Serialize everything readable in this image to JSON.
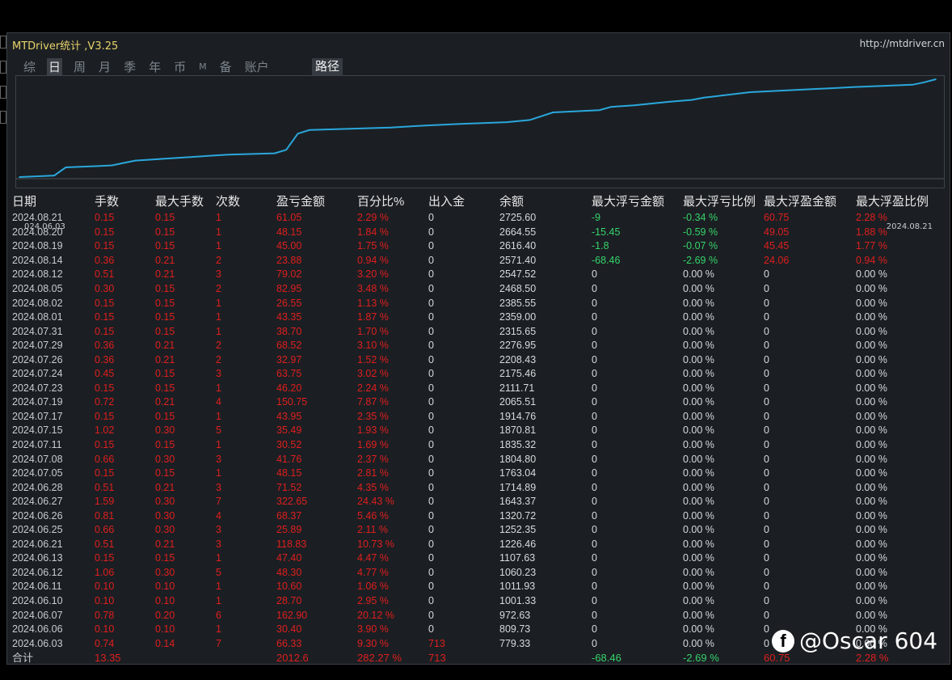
{
  "window": {
    "title": "MTDriver统计 ,V3.25",
    "url": "http://mtdriver.cn"
  },
  "tabs": [
    {
      "label": "综",
      "active": false
    },
    {
      "label": "日",
      "active": true
    },
    {
      "label": "周",
      "active": false
    },
    {
      "label": "月",
      "active": false
    },
    {
      "label": "季",
      "active": false
    },
    {
      "label": "年",
      "active": false
    },
    {
      "label": "币",
      "active": false
    },
    {
      "label": "M",
      "active": false
    },
    {
      "label": "备",
      "active": false
    },
    {
      "label": "账户",
      "active": false
    }
  ],
  "path_button": "路径",
  "chart_data": {
    "type": "line",
    "x_start_label": "024.06.03",
    "x_end_label": "2024.08.21",
    "x": [
      "2024.06.03",
      "2024.06.06",
      "2024.06.07",
      "2024.06.10",
      "2024.06.11",
      "2024.06.12",
      "2024.06.13",
      "2024.06.21",
      "2024.06.25",
      "2024.06.26",
      "2024.06.27",
      "2024.06.28",
      "2024.07.05",
      "2024.07.08",
      "2024.07.11",
      "2024.07.15",
      "2024.07.17",
      "2024.07.19",
      "2024.07.23",
      "2024.07.24",
      "2024.07.26",
      "2024.07.29",
      "2024.07.31",
      "2024.08.01",
      "2024.08.02",
      "2024.08.05",
      "2024.08.12",
      "2024.08.14",
      "2024.08.19",
      "2024.08.20",
      "2024.08.21"
    ],
    "values": [
      779.33,
      809.73,
      972.63,
      1001.33,
      1011.93,
      1060.23,
      1107.63,
      1226.46,
      1252.35,
      1320.72,
      1643.37,
      1714.89,
      1763.04,
      1804.8,
      1835.32,
      1870.81,
      1914.76,
      2065.51,
      2111.71,
      2175.46,
      2208.43,
      2276.95,
      2315.65,
      2359.0,
      2385.55,
      2468.5,
      2547.52,
      2571.4,
      2616.4,
      2664.55,
      2725.6
    ],
    "line_color": "#2aa7dc"
  },
  "table": {
    "headers": [
      "日期",
      "手数",
      "最大手数",
      "次数",
      "盈亏金额",
      "百分比%",
      "出入金",
      "余额",
      "最大浮亏金额",
      "最大浮亏比例",
      "最大浮盈金额",
      "最大浮盈比例"
    ],
    "rows": [
      [
        "2024.08.21",
        "0.15",
        "0.15",
        "1",
        "61.05",
        "2.29 %",
        "0",
        "2725.60",
        "-9",
        "-0.34 %",
        "60.75",
        "2.28 %"
      ],
      [
        "2024.08.20",
        "0.15",
        "0.15",
        "1",
        "48.15",
        "1.84 %",
        "0",
        "2664.55",
        "-15.45",
        "-0.59 %",
        "49.05",
        "1.88 %"
      ],
      [
        "2024.08.19",
        "0.15",
        "0.15",
        "1",
        "45.00",
        "1.75 %",
        "0",
        "2616.40",
        "-1.8",
        "-0.07 %",
        "45.45",
        "1.77 %"
      ],
      [
        "2024.08.14",
        "0.36",
        "0.21",
        "2",
        "23.88",
        "0.94 %",
        "0",
        "2571.40",
        "-68.46",
        "-2.69 %",
        "24.06",
        "0.94 %"
      ],
      [
        "2024.08.12",
        "0.51",
        "0.21",
        "3",
        "79.02",
        "3.20 %",
        "0",
        "2547.52",
        "0",
        "0.00 %",
        "0",
        "0.00 %"
      ],
      [
        "2024.08.05",
        "0.30",
        "0.15",
        "2",
        "82.95",
        "3.48 %",
        "0",
        "2468.50",
        "0",
        "0.00 %",
        "0",
        "0.00 %"
      ],
      [
        "2024.08.02",
        "0.15",
        "0.15",
        "1",
        "26.55",
        "1.13 %",
        "0",
        "2385.55",
        "0",
        "0.00 %",
        "0",
        "0.00 %"
      ],
      [
        "2024.08.01",
        "0.15",
        "0.15",
        "1",
        "43.35",
        "1.87 %",
        "0",
        "2359.00",
        "0",
        "0.00 %",
        "0",
        "0.00 %"
      ],
      [
        "2024.07.31",
        "0.15",
        "0.15",
        "1",
        "38.70",
        "1.70 %",
        "0",
        "2315.65",
        "0",
        "0.00 %",
        "0",
        "0.00 %"
      ],
      [
        "2024.07.29",
        "0.36",
        "0.21",
        "2",
        "68.52",
        "3.10 %",
        "0",
        "2276.95",
        "0",
        "0.00 %",
        "0",
        "0.00 %"
      ],
      [
        "2024.07.26",
        "0.36",
        "0.21",
        "2",
        "32.97",
        "1.52 %",
        "0",
        "2208.43",
        "0",
        "0.00 %",
        "0",
        "0.00 %"
      ],
      [
        "2024.07.24",
        "0.45",
        "0.15",
        "3",
        "63.75",
        "3.02 %",
        "0",
        "2175.46",
        "0",
        "0.00 %",
        "0",
        "0.00 %"
      ],
      [
        "2024.07.23",
        "0.15",
        "0.15",
        "1",
        "46.20",
        "2.24 %",
        "0",
        "2111.71",
        "0",
        "0.00 %",
        "0",
        "0.00 %"
      ],
      [
        "2024.07.19",
        "0.72",
        "0.21",
        "4",
        "150.75",
        "7.87 %",
        "0",
        "2065.51",
        "0",
        "0.00 %",
        "0",
        "0.00 %"
      ],
      [
        "2024.07.17",
        "0.15",
        "0.15",
        "1",
        "43.95",
        "2.35 %",
        "0",
        "1914.76",
        "0",
        "0.00 %",
        "0",
        "0.00 %"
      ],
      [
        "2024.07.15",
        "1.02",
        "0.30",
        "5",
        "35.49",
        "1.93 %",
        "0",
        "1870.81",
        "0",
        "0.00 %",
        "0",
        "0.00 %"
      ],
      [
        "2024.07.11",
        "0.15",
        "0.15",
        "1",
        "30.52",
        "1.69 %",
        "0",
        "1835.32",
        "0",
        "0.00 %",
        "0",
        "0.00 %"
      ],
      [
        "2024.07.08",
        "0.66",
        "0.30",
        "3",
        "41.76",
        "2.37 %",
        "0",
        "1804.80",
        "0",
        "0.00 %",
        "0",
        "0.00 %"
      ],
      [
        "2024.07.05",
        "0.15",
        "0.15",
        "1",
        "48.15",
        "2.81 %",
        "0",
        "1763.04",
        "0",
        "0.00 %",
        "0",
        "0.00 %"
      ],
      [
        "2024.06.28",
        "0.51",
        "0.21",
        "3",
        "71.52",
        "4.35 %",
        "0",
        "1714.89",
        "0",
        "0.00 %",
        "0",
        "0.00 %"
      ],
      [
        "2024.06.27",
        "1.59",
        "0.30",
        "7",
        "322.65",
        "24.43 %",
        "0",
        "1643.37",
        "0",
        "0.00 %",
        "0",
        "0.00 %"
      ],
      [
        "2024.06.26",
        "0.81",
        "0.30",
        "4",
        "68.37",
        "5.46 %",
        "0",
        "1320.72",
        "0",
        "0.00 %",
        "0",
        "0.00 %"
      ],
      [
        "2024.06.25",
        "0.66",
        "0.30",
        "3",
        "25.89",
        "2.11 %",
        "0",
        "1252.35",
        "0",
        "0.00 %",
        "0",
        "0.00 %"
      ],
      [
        "2024.06.21",
        "0.51",
        "0.21",
        "3",
        "118.83",
        "10.73 %",
        "0",
        "1226.46",
        "0",
        "0.00 %",
        "0",
        "0.00 %"
      ],
      [
        "2024.06.13",
        "0.15",
        "0.15",
        "1",
        "47.40",
        "4.47 %",
        "0",
        "1107.63",
        "0",
        "0.00 %",
        "0",
        "0.00 %"
      ],
      [
        "2024.06.12",
        "1.06",
        "0.30",
        "5",
        "48.30",
        "4.77 %",
        "0",
        "1060.23",
        "0",
        "0.00 %",
        "0",
        "0.00 %"
      ],
      [
        "2024.06.11",
        "0.10",
        "0.10",
        "1",
        "10.60",
        "1.06 %",
        "0",
        "1011.93",
        "0",
        "0.00 %",
        "0",
        "0.00 %"
      ],
      [
        "2024.06.10",
        "0.10",
        "0.10",
        "1",
        "28.70",
        "2.95 %",
        "0",
        "1001.33",
        "0",
        "0.00 %",
        "0",
        "0.00 %"
      ],
      [
        "2024.06.07",
        "0.78",
        "0.20",
        "6",
        "162.90",
        "20.12 %",
        "0",
        "972.63",
        "0",
        "0.00 %",
        "0",
        "0.00 %"
      ],
      [
        "2024.06.06",
        "0.10",
        "0.10",
        "1",
        "30.40",
        "3.90 %",
        "0",
        "809.73",
        "0",
        "0.00 %",
        "0",
        "0.00 %"
      ],
      [
        "2024.06.03",
        "0.74",
        "0.14",
        "7",
        "66.33",
        "9.30 %",
        "713",
        "779.33",
        "0",
        "0.00 %",
        "0",
        "0.00 %"
      ]
    ],
    "total": [
      "合计",
      "13.35",
      "",
      "",
      "2012.6",
      "282.27 %",
      "713",
      "",
      "-68.46",
      "-2.69 %",
      "60.75",
      "2.28 %"
    ]
  },
  "watermark": {
    "icon": "facebook-icon",
    "text": "@Oscar 604"
  },
  "colors": {
    "background": "#1b1f23",
    "negative": "#e01e1e",
    "positive": "#36d36a",
    "title": "#e8d36a"
  }
}
